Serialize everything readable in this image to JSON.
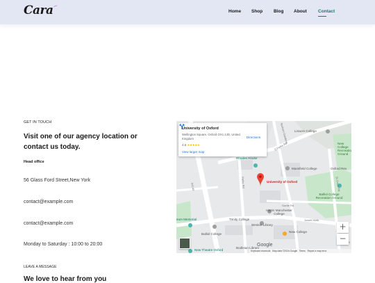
{
  "brand": {
    "logo_text": "Cara"
  },
  "nav": {
    "items": [
      {
        "label": "Home"
      },
      {
        "label": "Shop"
      },
      {
        "label": "Blog"
      },
      {
        "label": "About"
      },
      {
        "label": "Contact",
        "active": true
      }
    ]
  },
  "contact": {
    "eyebrow": "GET IN TOUCH",
    "heading": "Visit one of our agency location or contact us today.",
    "head_office_label": "Head office",
    "address": "56 Glass Ford Street,New York",
    "email_1": "contact@example.com",
    "email_2": "contact@example.com",
    "hours": "Monday to Saturday : 10:00 to 20:00"
  },
  "message": {
    "eyebrow": "LEAVE A MESSAGE",
    "heading": "We love to hear from you"
  },
  "map": {
    "card": {
      "title": "University of Oxford",
      "address": "Wellington Square, Oxford OX1 2JD, United Kingdom",
      "rating": "4.6",
      "stars": "★★★★★",
      "view_larger": "View larger map",
      "directions": "Directions"
    },
    "labels": {
      "linacre": "Linacre College",
      "new_college_rec": "New College Recreation Ground",
      "rhodes": "Rhodes House",
      "mansfield": "Mansfield College",
      "oxford_rev": "Oxford Rev",
      "university": "University of Oxford",
      "balliol_rec": "Balliol College Recreation Ground",
      "harris": "Harris Manchester College",
      "trinity": "Trinity College",
      "weston": "Weston Library",
      "museum": "eum Memorial",
      "balliol": "Balliol College",
      "new_college": "New College",
      "new_theatre": "New Theatre Oxford",
      "bodleian": "Bodleian Library",
      "s_parks": "S Parks Rd",
      "parks_rd": "Parks Rd",
      "a4144": "A4144",
      "holywell": "Holywell St",
      "jowett": "Jowett Walk",
      "savile": "Savile Rd",
      "st_cross": "St Cross Rd",
      "rose_pl": "Rose Pl",
      "norham": "Norham Gardens"
    },
    "zoom_in": "+",
    "zoom_out": "−",
    "google": "Google",
    "attribution": {
      "shortcuts": "Keyboard shortcuts",
      "data": "Map data ©2024 Google",
      "terms": "Terms",
      "report": "Report a map error"
    },
    "colors": {
      "park": "#c8e6c9",
      "road": "#ffffff",
      "pin": "#ea4335",
      "poi_teal": "#4db6ac",
      "poi_orange": "#f9a825"
    }
  }
}
